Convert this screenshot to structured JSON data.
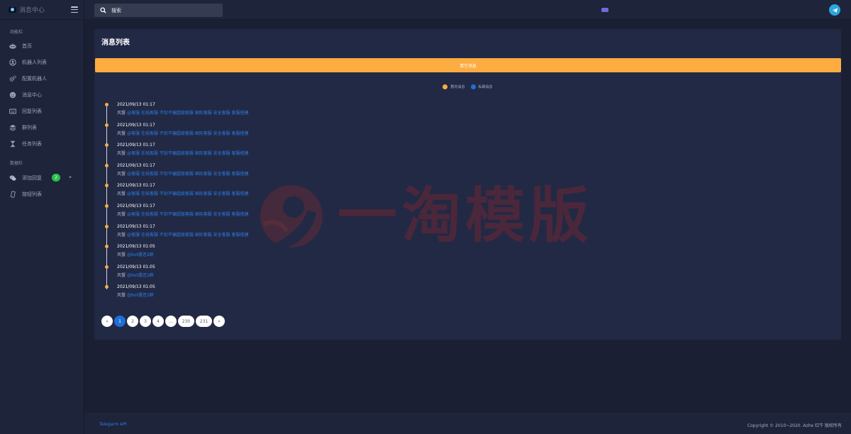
{
  "brand": {
    "name": "消息中心"
  },
  "sidebar": {
    "section_function": "功能栏",
    "section_data": "数据栏",
    "function_items": [
      {
        "label": "首页",
        "icon": "robot-face-icon"
      },
      {
        "label": "机器人列表",
        "icon": "user-circle-icon"
      },
      {
        "label": "配置机器人",
        "icon": "gears-icon"
      },
      {
        "label": "消息中心",
        "icon": "smile-icon"
      },
      {
        "label": "回复列表",
        "icon": "keyboard-icon"
      },
      {
        "label": "群列表",
        "icon": "layers-icon"
      },
      {
        "label": "任务列表",
        "icon": "hourglass-icon"
      }
    ],
    "data_items": [
      {
        "label": "添加回复",
        "icon": "chat-bubbles-icon",
        "badge": "2"
      },
      {
        "label": "按钮列表",
        "icon": "mobile-icon"
      }
    ]
  },
  "search": {
    "placeholder": "搜索",
    "value": ""
  },
  "main": {
    "title": "消息列表",
    "clear_button": "清空消息",
    "legend": [
      {
        "label": "群内消息",
        "color": "#fdac41"
      },
      {
        "label": "私聊消息",
        "color": "#1e6fd9"
      }
    ],
    "messages": [
      {
        "time": "2021/09/13 01:17",
        "sender": "风蟹",
        "text": "@客服 在线客服 不封不骗超级客服 国际客服 安全客服 客服搭建"
      },
      {
        "time": "2021/09/13 01:17",
        "sender": "风蟹",
        "text": "@客服 在线客服 不封不骗超级客服 国际客服 安全客服 客服搭建"
      },
      {
        "time": "2021/09/13 01:17",
        "sender": "风蟹",
        "text": "@客服 在线客服 不封不骗超级客服 国际客服 安全客服 客服搭建"
      },
      {
        "time": "2021/09/13 01:17",
        "sender": "风蟹",
        "text": "@客服 在线客服 不封不骗超级客服 国际客服 安全客服 客服搭建"
      },
      {
        "time": "2021/09/13 01:17",
        "sender": "风蟹",
        "text": "@客服 在线客服 不封不骗超级客服 国际客服 安全客服 客服搭建"
      },
      {
        "time": "2021/09/13 01:17",
        "sender": "风蟹",
        "text": "@客服 在线客服 不封不骗超级客服 国际客服 安全客服 客服搭建"
      },
      {
        "time": "2021/09/13 01:17",
        "sender": "风蟹",
        "text": "@客服 在线客服 不封不骗超级客服 国际客服 安全客服 客服搭建"
      },
      {
        "time": "2021/09/13 01:05",
        "sender": "风蟹",
        "text": "@bot邀还2群"
      },
      {
        "time": "2021/09/13 01:05",
        "sender": "风蟹",
        "text": "@bot邀还2群"
      },
      {
        "time": "2021/09/13 01:05",
        "sender": "风蟹",
        "text": "@bot邀还2群"
      }
    ],
    "pagination": [
      "«",
      "1",
      "2",
      "3",
      "4",
      "...",
      "230",
      "231",
      "»"
    ],
    "current_page": "1"
  },
  "watermark": {
    "text": "一淘模版"
  },
  "footer": {
    "link": "Telegarm API",
    "copyright": "Copyright © 2010~2020. Azhe 红牛 版权所有"
  },
  "colors": {
    "accent": "#fdac41",
    "primary": "#1e6fd9",
    "badge": "#26c24a",
    "telegram": "#2ca5e0"
  }
}
